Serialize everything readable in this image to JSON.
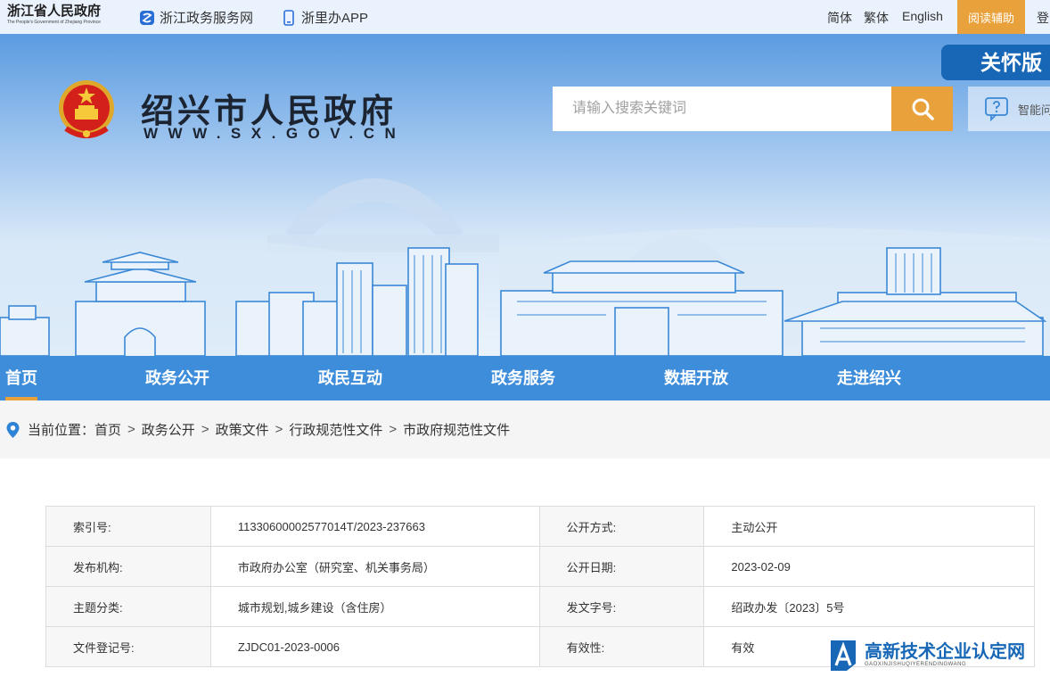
{
  "topbar": {
    "province_logo_cn": "浙江省人民政府",
    "province_logo_en": "The People's Government of Zhejiang Province",
    "link_gov_service": "浙江政务服务网",
    "link_app": "浙里办APP",
    "lang_simplified": "简体",
    "lang_traditional": "繁体",
    "lang_english": "English",
    "reading_aid": "阅读辅助",
    "login": "登"
  },
  "header": {
    "site_name": "绍兴市人民政府",
    "site_url": "WWW.SX.GOV.CN",
    "search_placeholder": "请输入搜索关键词",
    "care_version": "关怀版",
    "smart_qa": "智能问"
  },
  "nav": {
    "items": [
      {
        "label": "首页",
        "active": true
      },
      {
        "label": "政务公开",
        "active": false
      },
      {
        "label": "政民互动",
        "active": false
      },
      {
        "label": "政务服务",
        "active": false
      },
      {
        "label": "数据开放",
        "active": false
      },
      {
        "label": "走进绍兴",
        "active": false
      }
    ]
  },
  "breadcrumb": {
    "prefix": "当前位置：",
    "items": [
      "首页",
      "政务公开",
      "政策文件",
      "行政规范性文件",
      "市政府规范性文件"
    ]
  },
  "info_table": {
    "rows": [
      {
        "label1": "索引号:",
        "value1": "11330600002577014T/2023-237663",
        "label2": "公开方式:",
        "value2": "主动公开"
      },
      {
        "label1": "发布机构:",
        "value1": "市政府办公室（研究室、机关事务局）",
        "label2": "公开日期:",
        "value2": "2023-02-09"
      },
      {
        "label1": "主题分类:",
        "value1": "城市规划,城乡建设（含住房）",
        "label2": "发文字号:",
        "value2": "绍政办发〔2023〕5号"
      },
      {
        "label1": "文件登记号:",
        "value1": "ZJDC01-2023-0006",
        "label2": "有效性:",
        "value2": "有效"
      }
    ]
  },
  "watermark": {
    "cn": "高新技术企业认定网",
    "en": "GAOXINJISHUQIYERENDINGWANG"
  },
  "colors": {
    "nav_blue": "#3d8ddb",
    "accent_orange": "#e9a23b",
    "care_blue": "#1767b6"
  },
  "icons": [
    "gov-service-icon",
    "phone-app-icon",
    "national-emblem-icon",
    "search-icon",
    "chat-question-icon",
    "location-pin-icon",
    "watermark-logo-icon"
  ]
}
